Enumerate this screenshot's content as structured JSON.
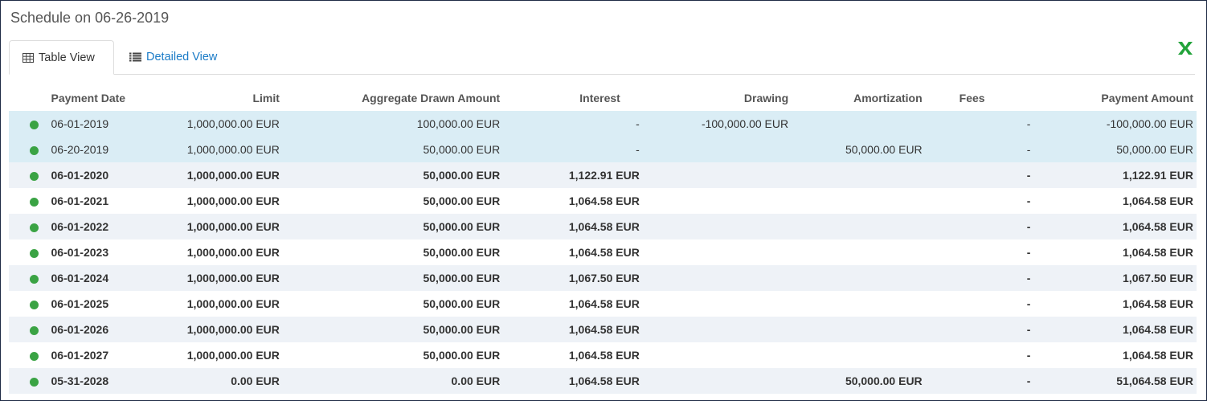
{
  "title": "Schedule on 06-26-2019",
  "tabs": {
    "table_view": "Table View",
    "detailed_view": "Detailed View"
  },
  "icons": {
    "table_view": "table-grid-icon",
    "detailed_view": "list-icon",
    "export": "excel-export-icon"
  },
  "colors": {
    "status_dot": "#3aa344",
    "highlight_row": "#daedf5",
    "link": "#1a7bc7",
    "excel": "#22a33a"
  },
  "columns": [
    "Payment Date",
    "Limit",
    "Aggregate Drawn Amount",
    "Interest",
    "Drawing",
    "Amortization",
    "Fees",
    "Payment Amount"
  ],
  "rows": [
    {
      "date": "06-01-2019",
      "limit": "1,000,000.00 EUR",
      "aggregate": "100,000.00 EUR",
      "interest": "-",
      "drawing": "-100,000.00 EUR",
      "amortization": "",
      "fees": "-",
      "payment": "-100,000.00 EUR",
      "style": "hl"
    },
    {
      "date": "06-20-2019",
      "limit": "1,000,000.00 EUR",
      "aggregate": "50,000.00 EUR",
      "interest": "-",
      "drawing": "",
      "amortization": "50,000.00 EUR",
      "fees": "-",
      "payment": "50,000.00 EUR",
      "style": "hl"
    },
    {
      "date": "06-01-2020",
      "limit": "1,000,000.00 EUR",
      "aggregate": "50,000.00 EUR",
      "interest": "1,122.91 EUR",
      "drawing": "",
      "amortization": "",
      "fees": "-",
      "payment": "1,122.91 EUR",
      "style": "odd"
    },
    {
      "date": "06-01-2021",
      "limit": "1,000,000.00 EUR",
      "aggregate": "50,000.00 EUR",
      "interest": "1,064.58 EUR",
      "drawing": "",
      "amortization": "",
      "fees": "-",
      "payment": "1,064.58 EUR",
      "style": "even"
    },
    {
      "date": "06-01-2022",
      "limit": "1,000,000.00 EUR",
      "aggregate": "50,000.00 EUR",
      "interest": "1,064.58 EUR",
      "drawing": "",
      "amortization": "",
      "fees": "-",
      "payment": "1,064.58 EUR",
      "style": "odd"
    },
    {
      "date": "06-01-2023",
      "limit": "1,000,000.00 EUR",
      "aggregate": "50,000.00 EUR",
      "interest": "1,064.58 EUR",
      "drawing": "",
      "amortization": "",
      "fees": "-",
      "payment": "1,064.58 EUR",
      "style": "even"
    },
    {
      "date": "06-01-2024",
      "limit": "1,000,000.00 EUR",
      "aggregate": "50,000.00 EUR",
      "interest": "1,067.50 EUR",
      "drawing": "",
      "amortization": "",
      "fees": "-",
      "payment": "1,067.50 EUR",
      "style": "odd"
    },
    {
      "date": "06-01-2025",
      "limit": "1,000,000.00 EUR",
      "aggregate": "50,000.00 EUR",
      "interest": "1,064.58 EUR",
      "drawing": "",
      "amortization": "",
      "fees": "-",
      "payment": "1,064.58 EUR",
      "style": "even"
    },
    {
      "date": "06-01-2026",
      "limit": "1,000,000.00 EUR",
      "aggregate": "50,000.00 EUR",
      "interest": "1,064.58 EUR",
      "drawing": "",
      "amortization": "",
      "fees": "-",
      "payment": "1,064.58 EUR",
      "style": "odd"
    },
    {
      "date": "06-01-2027",
      "limit": "1,000,000.00 EUR",
      "aggregate": "50,000.00 EUR",
      "interest": "1,064.58 EUR",
      "drawing": "",
      "amortization": "",
      "fees": "-",
      "payment": "1,064.58 EUR",
      "style": "even"
    },
    {
      "date": "05-31-2028",
      "limit": "0.00 EUR",
      "aggregate": "0.00 EUR",
      "interest": "1,064.58 EUR",
      "drawing": "",
      "amortization": "50,000.00 EUR",
      "fees": "-",
      "payment": "51,064.58 EUR",
      "style": "odd"
    }
  ]
}
